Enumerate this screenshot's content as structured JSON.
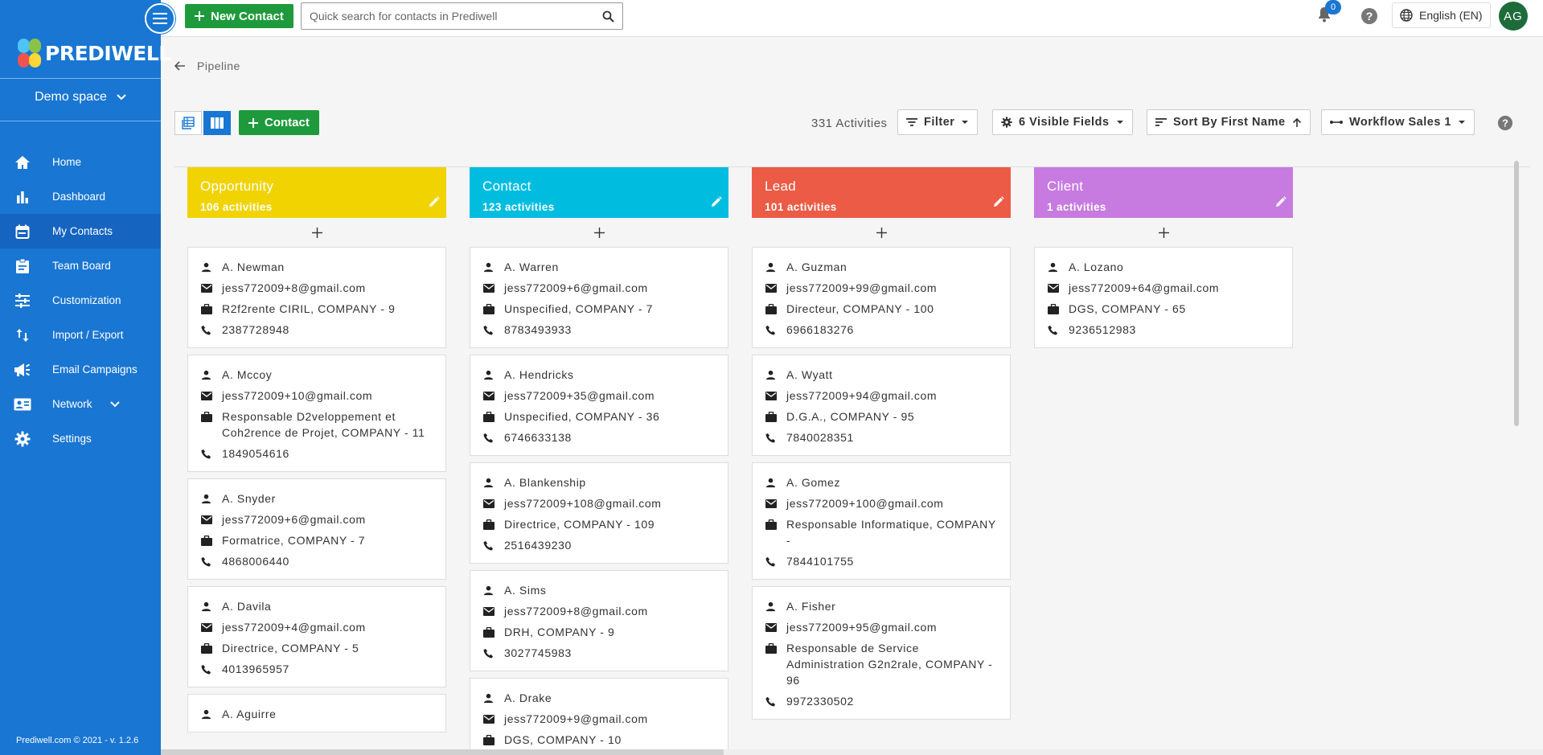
{
  "brand": {
    "name": "PREDIWELL"
  },
  "sidebar": {
    "space": "Demo space",
    "items": [
      {
        "label": "Home",
        "icon": "home-icon"
      },
      {
        "label": "Dashboard",
        "icon": "bar-chart-icon"
      },
      {
        "label": "My Contacts",
        "icon": "calendar-icon"
      },
      {
        "label": "Team Board",
        "icon": "clipboard-icon"
      },
      {
        "label": "Customization",
        "icon": "sliders-icon"
      },
      {
        "label": "Import / Export",
        "icon": "import-export-icon"
      },
      {
        "label": "Email Campaigns",
        "icon": "megaphone-icon"
      },
      {
        "label": "Network",
        "icon": "contact-card-icon"
      },
      {
        "label": "Settings",
        "icon": "gear-icon"
      }
    ],
    "active": "My Contacts",
    "footer": "Prediwell.com © 2021 - v. 1.2.6"
  },
  "topbar": {
    "new_contact": "New Contact",
    "search_placeholder": "Quick search for contacts in Prediwell",
    "notifications": "0",
    "language": "English (EN)",
    "avatar": "AG"
  },
  "breadcrumb": "Pipeline",
  "toolbar": {
    "add_contact": "Contact",
    "activities": "331 Activities",
    "filter": "Filter",
    "visible_fields": "6 Visible Fields",
    "sort": "Sort By First Name",
    "workflow": "Workflow Sales 1"
  },
  "colors": {
    "sidebar": "#1976d2",
    "green": "#1e9a3c",
    "opportunity": "#f1d302",
    "contact": "#00bde0",
    "lead": "#ec5b45",
    "client": "#c77ae0"
  },
  "columns": [
    {
      "title": "Opportunity",
      "sub": "106 activities",
      "color": "#f1d302",
      "cards": [
        {
          "name": "A. Newman",
          "email": "jess772009+8@gmail.com",
          "company": "R2f2rente CIRIL, COMPANY - 9",
          "phone": "2387728948"
        },
        {
          "name": "A. Mccoy",
          "email": "jess772009+10@gmail.com",
          "company": "Responsable D2veloppement et Coh2rence de Projet, COMPANY - 11",
          "phone": "1849054616"
        },
        {
          "name": "A. Snyder",
          "email": "jess772009+6@gmail.com",
          "company": "Formatrice, COMPANY - 7",
          "phone": "4868006440"
        },
        {
          "name": "A. Davila",
          "email": "jess772009+4@gmail.com",
          "company": "Directrice, COMPANY - 5",
          "phone": "4013965957"
        },
        {
          "name": "A. Aguirre",
          "email": "",
          "company": "",
          "phone": ""
        }
      ]
    },
    {
      "title": "Contact",
      "sub": "123 activities",
      "color": "#00bde0",
      "cards": [
        {
          "name": "A. Warren",
          "email": "jess772009+6@gmail.com",
          "company": "Unspecified, COMPANY - 7",
          "phone": "8783493933"
        },
        {
          "name": "A. Hendricks",
          "email": "jess772009+35@gmail.com",
          "company": "Unspecified, COMPANY - 36",
          "phone": "6746633138"
        },
        {
          "name": "A. Blankenship",
          "email": "jess772009+108@gmail.com",
          "company": "Directrice, COMPANY - 109",
          "phone": "2516439230"
        },
        {
          "name": "A. Sims",
          "email": "jess772009+8@gmail.com",
          "company": "DRH, COMPANY - 9",
          "phone": "3027745983"
        },
        {
          "name": "A. Drake",
          "email": "jess772009+9@gmail.com",
          "company": "DGS, COMPANY - 10",
          "phone": ""
        }
      ]
    },
    {
      "title": "Lead",
      "sub": "101 activities",
      "color": "#ec5b45",
      "cards": [
        {
          "name": "A. Guzman",
          "email": "jess772009+99@gmail.com",
          "company": "Directeur, COMPANY - 100",
          "phone": "6966183276"
        },
        {
          "name": "A. Wyatt",
          "email": "jess772009+94@gmail.com",
          "company": "D.G.A., COMPANY - 95",
          "phone": "7840028351"
        },
        {
          "name": "A. Gomez",
          "email": "jess772009+100@gmail.com",
          "company": "Responsable Informatique, COMPANY -",
          "phone": "7844101755"
        },
        {
          "name": "A. Fisher",
          "email": "jess772009+95@gmail.com",
          "company": "Responsable de Service Administration G2n2rale, COMPANY - 96",
          "phone": "9972330502"
        }
      ]
    },
    {
      "title": "Client",
      "sub": "1 activities",
      "color": "#c77ae0",
      "cards": [
        {
          "name": "A. Lozano",
          "email": "jess772009+64@gmail.com",
          "company": "DGS, COMPANY - 65",
          "phone": "9236512983"
        }
      ]
    }
  ]
}
